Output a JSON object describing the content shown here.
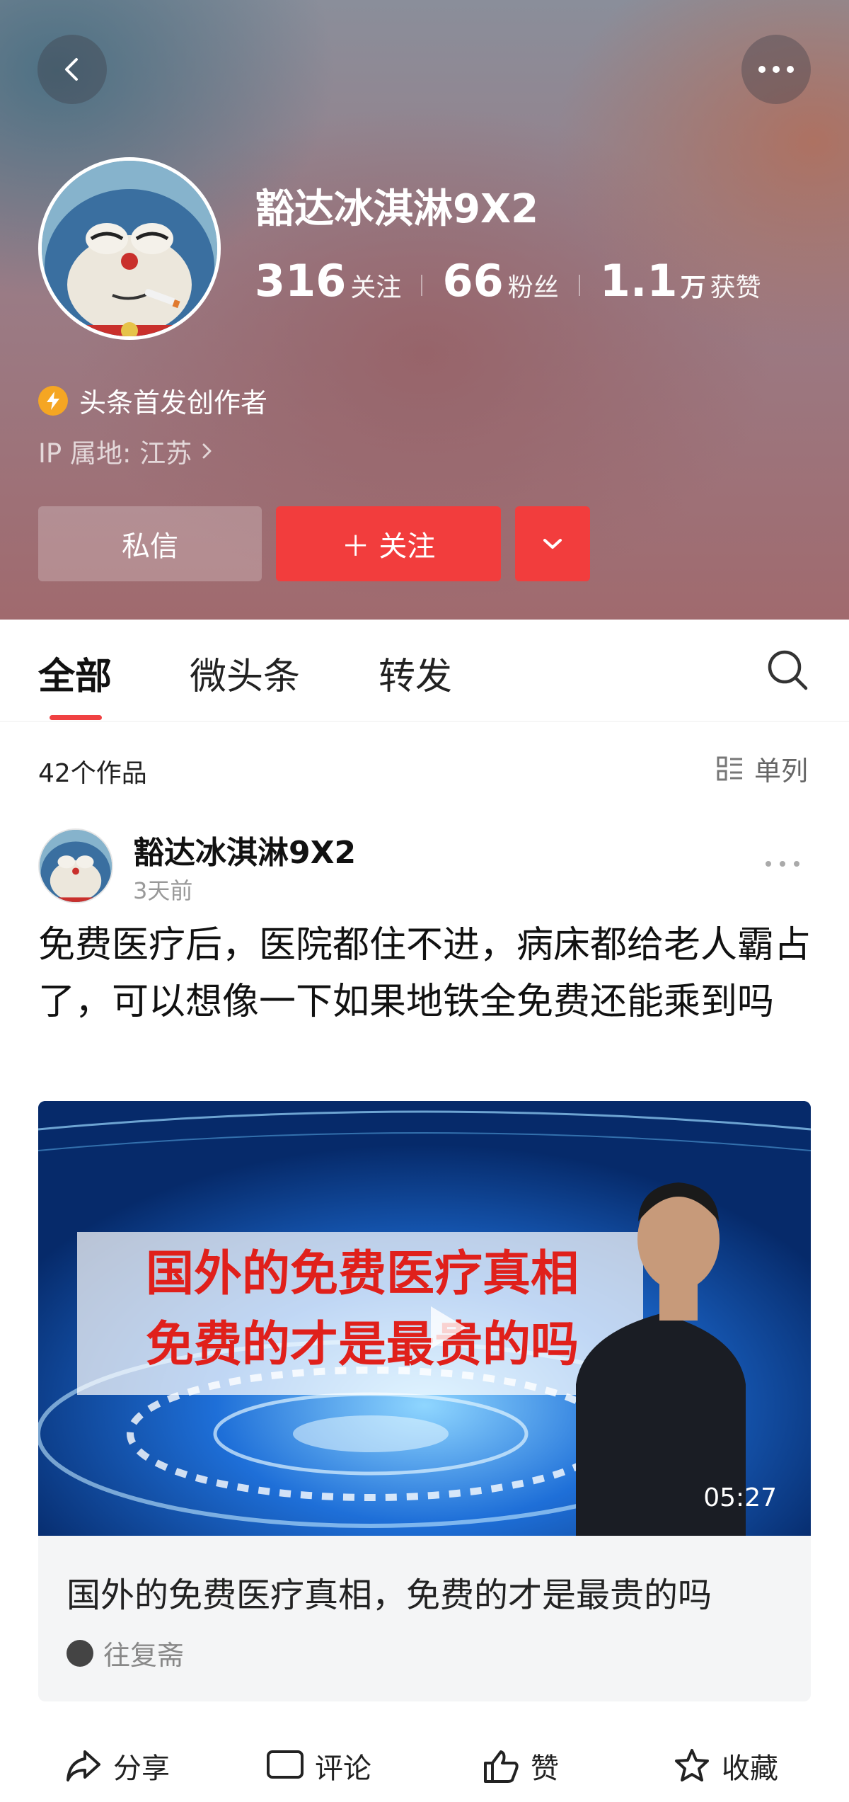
{
  "profile": {
    "name": "豁达冰淇淋9X2",
    "stats": [
      {
        "num": "316",
        "unit": "",
        "label": "关注"
      },
      {
        "num": "66",
        "unit": "",
        "label": "粉丝"
      },
      {
        "num": "1.1",
        "unit": "万",
        "label": "获赞"
      }
    ],
    "badge": "头条首发创作者",
    "ip": "IP 属地: 江苏",
    "buttons": {
      "message": "私信",
      "follow": "＋ 关注"
    }
  },
  "tabs": [
    {
      "label": "全部",
      "active": true
    },
    {
      "label": "微头条",
      "active": false
    },
    {
      "label": "转发",
      "active": false
    }
  ],
  "works": {
    "count": "42个作品",
    "view_mode": "单列"
  },
  "post": {
    "author": "豁达冰淇淋9X2",
    "time": "3天前",
    "text": "免费医疗后，医院都住不进，病床都给老人霸占了，可以想像一下如果地铁全免费还能乘到吗",
    "video": {
      "overlay_line1": "国外的免费医疗真相",
      "overlay_line2": "免费的才是最贵的吗",
      "duration": "05:27",
      "title": "国外的免费医疗真相，免费的才是最贵的吗",
      "source": "往复斋"
    },
    "actions": [
      "分享",
      "评论",
      "赞",
      "收藏"
    ]
  },
  "colors": {
    "accent": "#f23d3d",
    "badge": "#f5a623"
  }
}
